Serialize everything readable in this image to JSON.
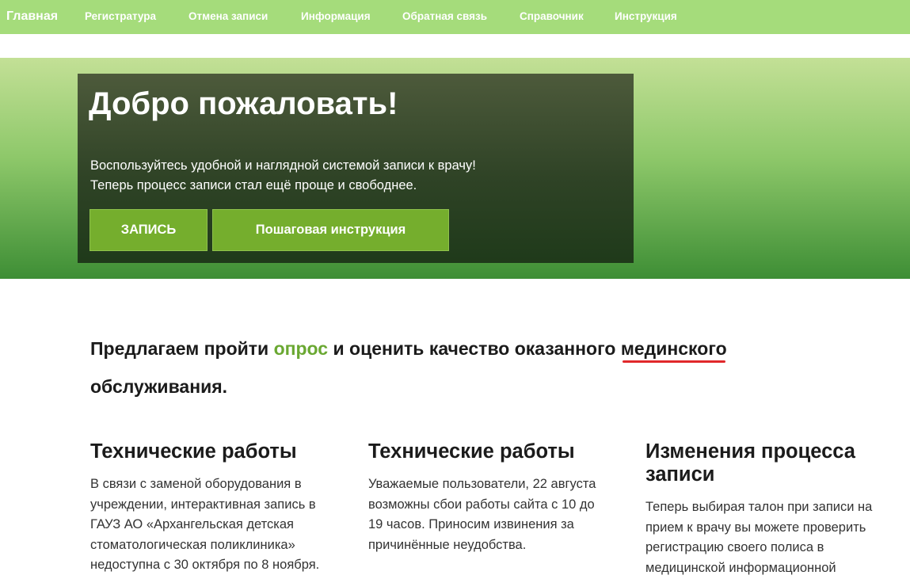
{
  "nav": {
    "brand": "Главная",
    "items": [
      "Регистратура",
      "Отмена записи",
      "Информация",
      "Обратная связь",
      "Справочник",
      "Инструкция"
    ]
  },
  "hero": {
    "title": "Добро пожаловать!",
    "line1": "Воспользуйтесь удобной и наглядной системой записи к врачу!",
    "line2": "Теперь процесс записи стал ещё проще и свободнее.",
    "primary_button": "ЗАПИСЬ",
    "secondary_button": "Пошаговая инструкция"
  },
  "survey": {
    "prefix": "Предлагаем пройти ",
    "link": "опрос",
    "middle": " и оценить качество оказанного ",
    "misspelled_word": "мединского",
    "line2": "обслуживания."
  },
  "news": [
    {
      "title": "Технические работы",
      "lines": [
        "В связи с заменой оборудования в",
        "учреждении, интерактивная запись в",
        "ГАУЗ АО «Архангельская детская",
        "стоматологическая поликлиника»",
        "недоступна с 30 октября по 8 ноября."
      ]
    },
    {
      "title": "Технические работы",
      "lines": [
        "Уважаемые пользователи, 22 августа",
        "возможны сбои работы сайта с 10 до",
        "19 часов. Приносим извинения за",
        "причинённые неудобства."
      ]
    },
    {
      "title_lines": [
        "Изменения процесса",
        "записи"
      ],
      "lines": [
        "Теперь выбирая талон при записи на",
        "прием к врачу вы можете проверить",
        "регистрацию своего полиса в",
        "медицинской информационной"
      ]
    }
  ],
  "colors": {
    "nav_bg": "#a5dc7b",
    "button_green": "#75ae2d",
    "link_green": "#6aa832",
    "spellcheck_red": "#e0282b"
  }
}
